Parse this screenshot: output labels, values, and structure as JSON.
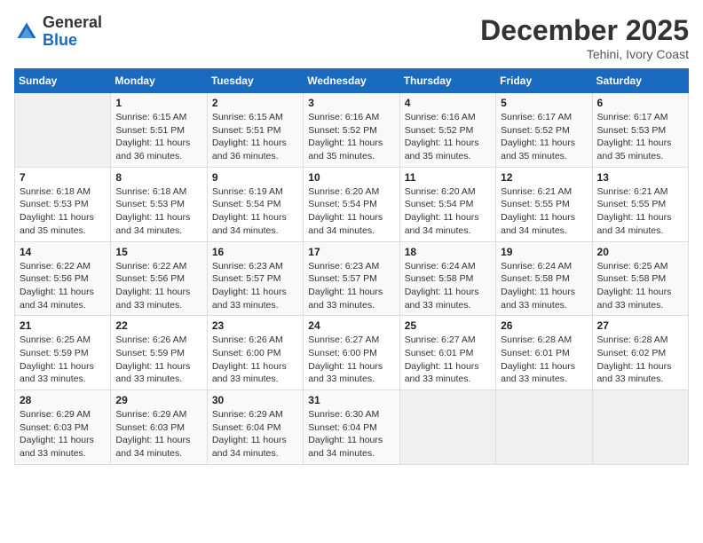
{
  "header": {
    "logo_general": "General",
    "logo_blue": "Blue",
    "month_title": "December 2025",
    "location": "Tehini, Ivory Coast"
  },
  "days_of_week": [
    "Sunday",
    "Monday",
    "Tuesday",
    "Wednesday",
    "Thursday",
    "Friday",
    "Saturday"
  ],
  "weeks": [
    [
      {
        "day": "",
        "info": ""
      },
      {
        "day": "1",
        "info": "Sunrise: 6:15 AM\nSunset: 5:51 PM\nDaylight: 11 hours and 36 minutes."
      },
      {
        "day": "2",
        "info": "Sunrise: 6:15 AM\nSunset: 5:51 PM\nDaylight: 11 hours and 36 minutes."
      },
      {
        "day": "3",
        "info": "Sunrise: 6:16 AM\nSunset: 5:52 PM\nDaylight: 11 hours and 35 minutes."
      },
      {
        "day": "4",
        "info": "Sunrise: 6:16 AM\nSunset: 5:52 PM\nDaylight: 11 hours and 35 minutes."
      },
      {
        "day": "5",
        "info": "Sunrise: 6:17 AM\nSunset: 5:52 PM\nDaylight: 11 hours and 35 minutes."
      },
      {
        "day": "6",
        "info": "Sunrise: 6:17 AM\nSunset: 5:53 PM\nDaylight: 11 hours and 35 minutes."
      }
    ],
    [
      {
        "day": "7",
        "info": "Sunrise: 6:18 AM\nSunset: 5:53 PM\nDaylight: 11 hours and 35 minutes."
      },
      {
        "day": "8",
        "info": "Sunrise: 6:18 AM\nSunset: 5:53 PM\nDaylight: 11 hours and 34 minutes."
      },
      {
        "day": "9",
        "info": "Sunrise: 6:19 AM\nSunset: 5:54 PM\nDaylight: 11 hours and 34 minutes."
      },
      {
        "day": "10",
        "info": "Sunrise: 6:20 AM\nSunset: 5:54 PM\nDaylight: 11 hours and 34 minutes."
      },
      {
        "day": "11",
        "info": "Sunrise: 6:20 AM\nSunset: 5:54 PM\nDaylight: 11 hours and 34 minutes."
      },
      {
        "day": "12",
        "info": "Sunrise: 6:21 AM\nSunset: 5:55 PM\nDaylight: 11 hours and 34 minutes."
      },
      {
        "day": "13",
        "info": "Sunrise: 6:21 AM\nSunset: 5:55 PM\nDaylight: 11 hours and 34 minutes."
      }
    ],
    [
      {
        "day": "14",
        "info": "Sunrise: 6:22 AM\nSunset: 5:56 PM\nDaylight: 11 hours and 34 minutes."
      },
      {
        "day": "15",
        "info": "Sunrise: 6:22 AM\nSunset: 5:56 PM\nDaylight: 11 hours and 33 minutes."
      },
      {
        "day": "16",
        "info": "Sunrise: 6:23 AM\nSunset: 5:57 PM\nDaylight: 11 hours and 33 minutes."
      },
      {
        "day": "17",
        "info": "Sunrise: 6:23 AM\nSunset: 5:57 PM\nDaylight: 11 hours and 33 minutes."
      },
      {
        "day": "18",
        "info": "Sunrise: 6:24 AM\nSunset: 5:58 PM\nDaylight: 11 hours and 33 minutes."
      },
      {
        "day": "19",
        "info": "Sunrise: 6:24 AM\nSunset: 5:58 PM\nDaylight: 11 hours and 33 minutes."
      },
      {
        "day": "20",
        "info": "Sunrise: 6:25 AM\nSunset: 5:58 PM\nDaylight: 11 hours and 33 minutes."
      }
    ],
    [
      {
        "day": "21",
        "info": "Sunrise: 6:25 AM\nSunset: 5:59 PM\nDaylight: 11 hours and 33 minutes."
      },
      {
        "day": "22",
        "info": "Sunrise: 6:26 AM\nSunset: 5:59 PM\nDaylight: 11 hours and 33 minutes."
      },
      {
        "day": "23",
        "info": "Sunrise: 6:26 AM\nSunset: 6:00 PM\nDaylight: 11 hours and 33 minutes."
      },
      {
        "day": "24",
        "info": "Sunrise: 6:27 AM\nSunset: 6:00 PM\nDaylight: 11 hours and 33 minutes."
      },
      {
        "day": "25",
        "info": "Sunrise: 6:27 AM\nSunset: 6:01 PM\nDaylight: 11 hours and 33 minutes."
      },
      {
        "day": "26",
        "info": "Sunrise: 6:28 AM\nSunset: 6:01 PM\nDaylight: 11 hours and 33 minutes."
      },
      {
        "day": "27",
        "info": "Sunrise: 6:28 AM\nSunset: 6:02 PM\nDaylight: 11 hours and 33 minutes."
      }
    ],
    [
      {
        "day": "28",
        "info": "Sunrise: 6:29 AM\nSunset: 6:03 PM\nDaylight: 11 hours and 33 minutes."
      },
      {
        "day": "29",
        "info": "Sunrise: 6:29 AM\nSunset: 6:03 PM\nDaylight: 11 hours and 34 minutes."
      },
      {
        "day": "30",
        "info": "Sunrise: 6:29 AM\nSunset: 6:04 PM\nDaylight: 11 hours and 34 minutes."
      },
      {
        "day": "31",
        "info": "Sunrise: 6:30 AM\nSunset: 6:04 PM\nDaylight: 11 hours and 34 minutes."
      },
      {
        "day": "",
        "info": ""
      },
      {
        "day": "",
        "info": ""
      },
      {
        "day": "",
        "info": ""
      }
    ]
  ]
}
